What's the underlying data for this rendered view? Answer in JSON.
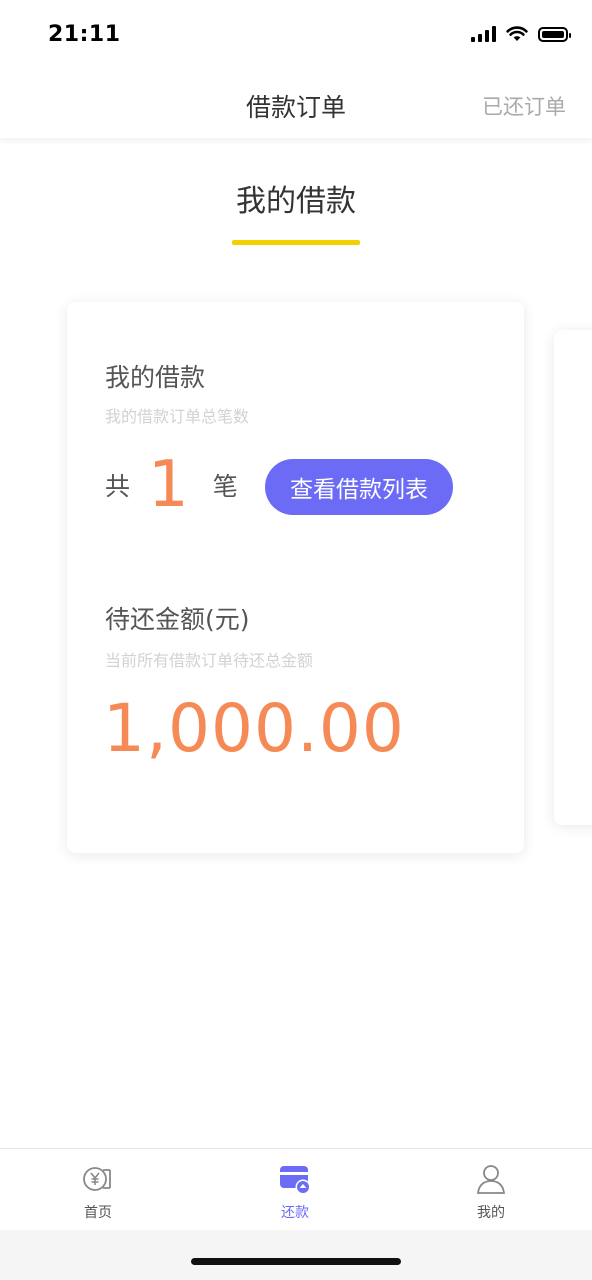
{
  "status_bar": {
    "time": "21:11"
  },
  "nav": {
    "title": "借款订单",
    "right_action": "已还订单"
  },
  "tab": {
    "label": "我的借款"
  },
  "card": {
    "loans_title": "我的借款",
    "loans_subtitle": "我的借款订单总笔数",
    "count_prefix": "共",
    "count": "1",
    "count_suffix": "笔",
    "view_button": "查看借款列表",
    "pending_title": "待还金额(元)",
    "pending_subtitle": "当前所有借款订单待还总金额",
    "pending_amount": "1,000.00"
  },
  "tabbar": {
    "items": [
      {
        "label": "首页",
        "icon": "yen-coin-icon",
        "active": false
      },
      {
        "label": "还款",
        "icon": "wallet-repay-icon",
        "active": true
      },
      {
        "label": "我的",
        "icon": "person-icon",
        "active": false
      }
    ]
  },
  "colors": {
    "accent": "#6b6bf6",
    "amount": "#f58a56",
    "underline": "#f5d000"
  }
}
